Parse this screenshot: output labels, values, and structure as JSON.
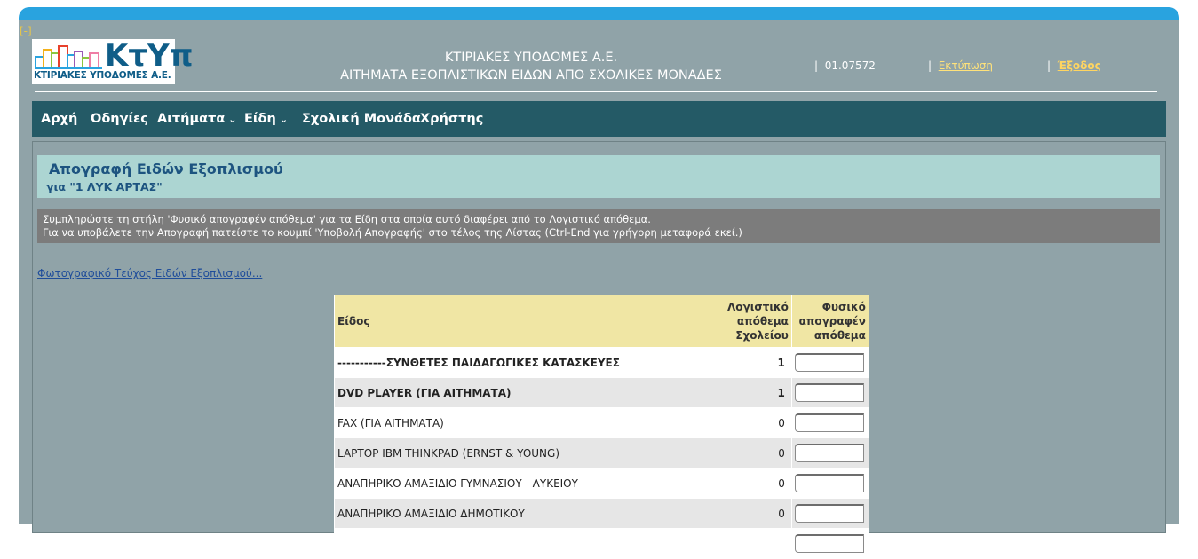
{
  "collapse_toggle": "[-]",
  "logo": {
    "wordmark": "ΚτΥπ",
    "subtitle": "ΚΤΙΡΙΑΚΕΣ ΥΠΟΔΟΜΕΣ Α.Ε.",
    "colors": [
      "#f3b11b",
      "#8cc63f",
      "#e8412c",
      "#29a3df",
      "#9b59b6",
      "#ef7ea5"
    ]
  },
  "header": {
    "title_line1": "ΚΤΙΡΙΑΚΕΣ ΥΠΟΔΟΜΕΣ Α.Ε.",
    "title_line2": "ΑΙΤΗΜΑΤΑ ΕΞΟΠΛΙΣΤΙΚΩΝ ΕΙΔΩΝ ΑΠΟ ΣΧΟΛΙΚΕΣ ΜΟΝΑΔΕΣ",
    "sep1": "|",
    "code": "01.07572",
    "sep2": "|",
    "print_label": "Εκτύπωση",
    "sep3": "|",
    "exit_label": "Έξοδος"
  },
  "nav": {
    "items": [
      "Αρχή",
      "Οδηγίες",
      "Αιτήματα",
      "Είδη",
      "Σχολική Μονάδα",
      "Χρήστης"
    ]
  },
  "page": {
    "title": "Απογραφή Ειδών Εξοπλισμού",
    "subtitle": "για \"1 ΛΥΚ ΑΡΤΑΣ\"",
    "info_line1": "Συμπληρώστε τη στήλη 'Φυσικό απογραφέν απόθεμα' για τα Είδη στα οποία αυτό διαφέρει από το Λογιστικό απόθεμα.",
    "info_line2": "Για να υποβάλετε την Απογραφή πατείστε το κουμπί 'Υποβολή Απογραφής' στο τέλος της Λίστας (Ctrl-End για γρήγορη μεταφορά εκεί.)",
    "photo_link": "Φωτογραφικό Τεύχος Ειδών Εξοπλισμού..."
  },
  "table": {
    "headers": {
      "item": "Είδος",
      "book_stock_l1": "Λογιστικό",
      "book_stock_l2": "απόθεμα",
      "book_stock_l3": "Σχολείου",
      "physical_l1": "Φυσικό",
      "physical_l2": "απογραφέν",
      "physical_l3": "απόθεμα"
    },
    "rows": [
      {
        "name": "-----------ΣΥΝΘΕΤΕΣ ΠΑΙΔΑΓΩΓΙΚΕΣ ΚΑΤΑΣΚΕΥΕΣ",
        "qty": "1",
        "bold": true
      },
      {
        "name": "DVD PLAYER (ΓΙΑ ΑΙΤΗΜΑΤΑ)",
        "qty": "1",
        "bold": true
      },
      {
        "name": "FAX (ΓΙΑ ΑΙΤΗΜΑΤΑ)",
        "qty": "0",
        "bold": false
      },
      {
        "name": "LAPTOP IBM THINKPAD (ERNST & YOUNG)",
        "qty": "0",
        "bold": false
      },
      {
        "name": "ΑΝΑΠΗΡΙΚΟ ΑΜΑΞΙΔΙΟ ΓΥΜΝΑΣΙΟΥ - ΛΥΚΕΙΟΥ",
        "qty": "0",
        "bold": false
      },
      {
        "name": "ΑΝΑΠΗΡΙΚΟ ΑΜΑΞΙΔΙΟ ΔΗΜΟΤΙΚΟΥ",
        "qty": "0",
        "bold": false
      },
      {
        "name": "",
        "qty": "",
        "bold": false
      }
    ]
  }
}
